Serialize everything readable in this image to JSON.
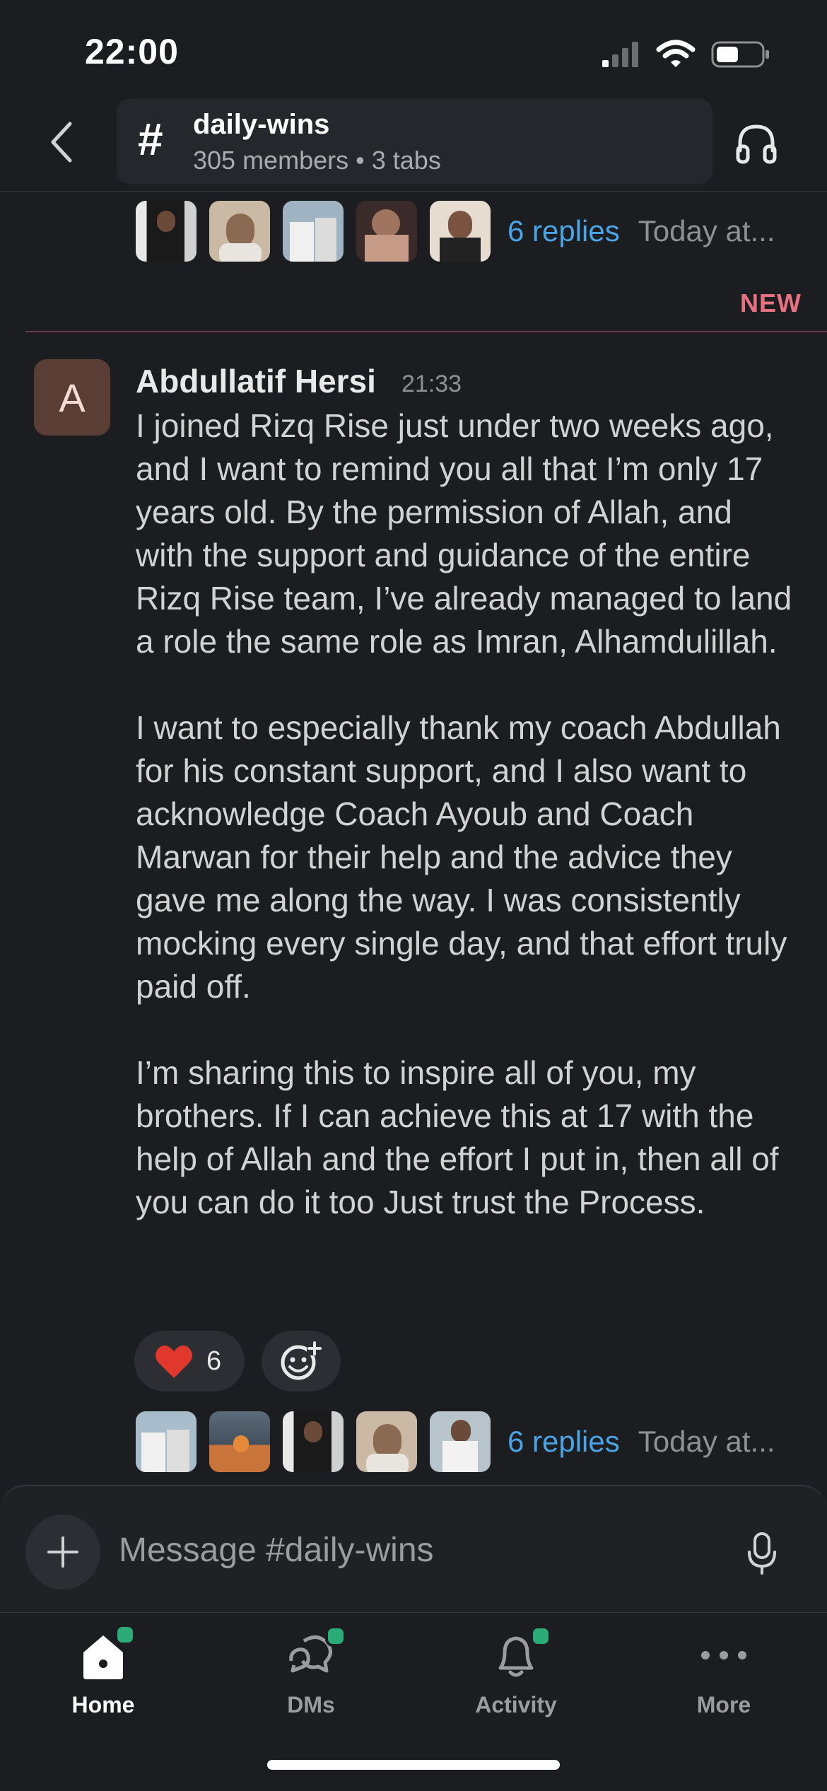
{
  "status_bar": {
    "time": "22:00"
  },
  "header": {
    "channel_name": "daily-wins",
    "hash_symbol": "#",
    "members": "305 members",
    "separator": "•",
    "tabs": "3 tabs"
  },
  "threads": [
    {
      "replies": "6 replies",
      "time": "Today at..."
    },
    {
      "replies": "6 replies",
      "time": "Today at..."
    }
  ],
  "new_divider": {
    "label": "NEW"
  },
  "message": {
    "avatar_letter": "A",
    "author": "Abdullatif Hersi",
    "time": "21:33",
    "paragraphs": [
      "I joined Rizq Rise just under two weeks ago, and I want to remind you all that I’m only 17 years old. By the permission of Allah, and with the support and guidance of the entire Rizq Rise team, I’ve already managed to land a role the same role as Imran, Alhamdulillah.",
      "I want to especially thank my coach Abdullah for his constant support, and I also want to acknowledge Coach Ayoub and Coach Marwan for their help and the advice they gave me along the way. I was consistently mocking every single day, and that effort truly paid off.",
      "I’m sharing this to inspire all of you, my brothers. If I can achieve this at 17 with the help of Allah and the effort I put in, then all of you can do it too Just trust the Process."
    ],
    "reactions": [
      {
        "emoji": "❤️",
        "count": "6"
      }
    ]
  },
  "composer": {
    "placeholder": "Message #daily-wins"
  },
  "tab_bar": {
    "items": [
      {
        "label": "Home"
      },
      {
        "label": "DMs"
      },
      {
        "label": "Activity"
      },
      {
        "label": "More"
      }
    ]
  },
  "colors": {
    "background": "#1b1d21",
    "link": "#4aa4e6",
    "new_label": "#e8727f",
    "presence_dot": "#2bac76"
  }
}
